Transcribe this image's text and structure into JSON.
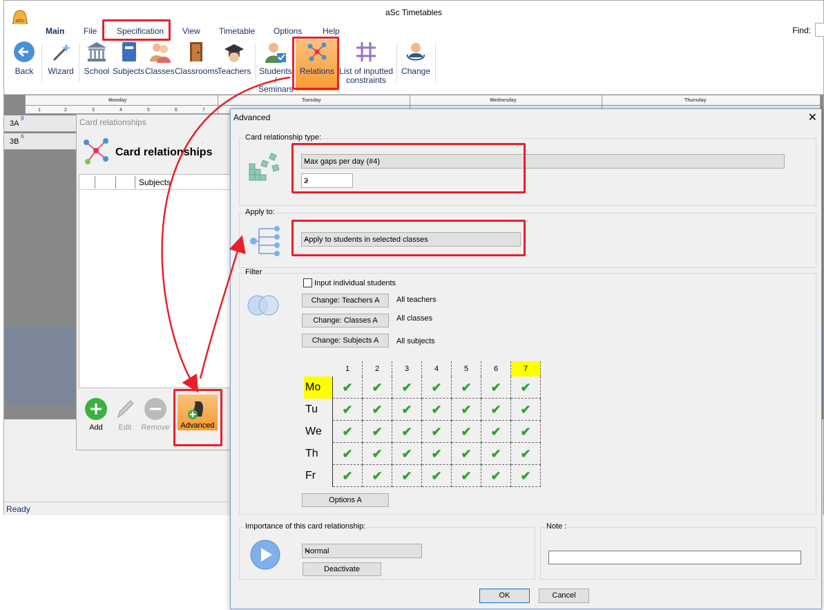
{
  "app": {
    "title": "aSc Timetables",
    "logo_text": "aSc"
  },
  "menu": {
    "items": [
      "Main",
      "File",
      "Specification",
      "View",
      "Timetable",
      "Options",
      "Help"
    ],
    "find_label": "Find:"
  },
  "ribbon": {
    "buttons": [
      {
        "label": "Back",
        "icon": "back-arrow-icon"
      },
      {
        "label": "Wizard",
        "icon": "magic-wand-icon"
      },
      {
        "label": "School",
        "icon": "school-building-icon"
      },
      {
        "label": "Subjects",
        "icon": "book-icon"
      },
      {
        "label": "Classes",
        "icon": "students-icon"
      },
      {
        "label": "Classrooms",
        "icon": "door-icon"
      },
      {
        "label": "Teachers",
        "icon": "graduation-cap-icon"
      },
      {
        "label": "Students /",
        "label2": "Seminars",
        "icon": "student-check-icon"
      },
      {
        "label": "Relations",
        "icon": "relations-network-icon"
      },
      {
        "label": "List of inputted",
        "label2": "constraints",
        "icon": "grid-hash-icon"
      },
      {
        "label": "Change",
        "icon": "change-user-icon"
      }
    ]
  },
  "timetable": {
    "days": [
      "Monday",
      "Tuesday",
      "Wednesday",
      "Thursday"
    ],
    "periods": [
      "1",
      "2",
      "3",
      "4",
      "5",
      "6",
      "7"
    ],
    "rows": [
      {
        "label": "3A",
        "badge": "9"
      },
      {
        "label": "3B",
        "badge": "6"
      }
    ]
  },
  "status": {
    "text": "Ready"
  },
  "card_relationships": {
    "window_title": "Card relationships",
    "heading": "Card relationships",
    "column_subjects": "Subjects",
    "buttons": {
      "add": "Add",
      "edit": "Edit",
      "remove": "Remove",
      "advanced": "Advanced"
    }
  },
  "advanced": {
    "title": "Advanced",
    "close": "✕",
    "relationship_type": {
      "legend": "Card relationship type:",
      "value": "Max gaps per day (#4)",
      "count": "2"
    },
    "apply_to": {
      "legend": "Apply to:",
      "value": "Apply to students in selected classes"
    },
    "filter": {
      "legend": "Filter",
      "individual_students_label": "Input individual students",
      "individual_students_checked": false,
      "teachers_button": "Change: Teachers A",
      "teachers_value": "All teachers",
      "classes_button": "Change: Classes A",
      "classes_value": "All classes",
      "subjects_button": "Change: Subjects A",
      "subjects_value": "All subjects"
    },
    "grid": {
      "periods": [
        "1",
        "2",
        "3",
        "4",
        "5",
        "6",
        "7"
      ],
      "days": [
        "Mo",
        "Tu",
        "We",
        "Th",
        "Fr"
      ],
      "highlight_period": "7",
      "highlight_day": "Mo",
      "highlight_color": "#ffff00",
      "all_checked": true
    },
    "options_button": "Options A",
    "importance": {
      "legend": "Importance of this card relationship:",
      "value": "Normal",
      "deactivate": "Deactivate"
    },
    "note": {
      "legend": "Note :",
      "value": ""
    },
    "ok": "OK",
    "cancel": "Cancel"
  },
  "colors": {
    "accent_highlight": "#e8202a",
    "ribbon_text": "#1a2f6a",
    "active_button": "#f7a44a",
    "check_green": "#2da52d"
  }
}
